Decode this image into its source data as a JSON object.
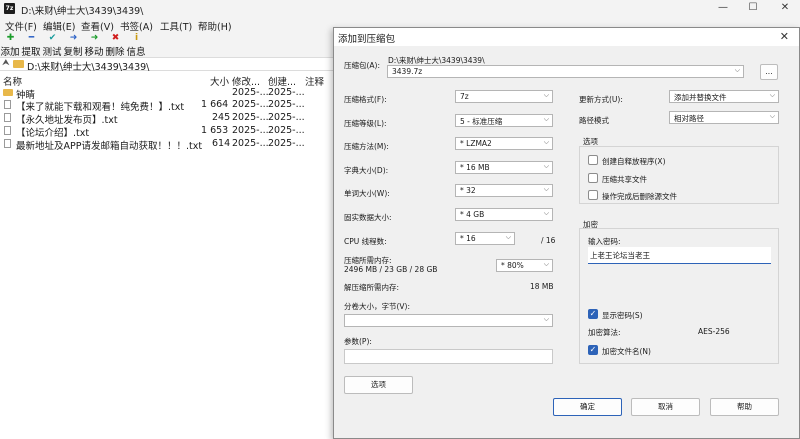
{
  "window": {
    "app_icon": "7z",
    "title": "D:\\来财\\绅士大\\3439\\3439\\"
  },
  "menu": [
    "文件(F)",
    "编辑(E)",
    "查看(V)",
    "书签(A)",
    "工具(T)",
    "帮助(H)"
  ],
  "toolbar": [
    {
      "label": "添加",
      "icon": "plus-icon",
      "glyph": "✚",
      "color": "#1a9c2a"
    },
    {
      "label": "提取",
      "icon": "minus-icon",
      "glyph": "━",
      "color": "#2e63c7"
    },
    {
      "label": "测试",
      "icon": "check-icon",
      "glyph": "✔",
      "color": "#1a9c9c"
    },
    {
      "label": "复制",
      "icon": "arrow-right-icon",
      "glyph": "➜",
      "color": "#2e63c7"
    },
    {
      "label": "移动",
      "icon": "arrow-move-icon",
      "glyph": "➜",
      "color": "#1a9c2a"
    },
    {
      "label": "删除",
      "icon": "x-icon",
      "glyph": "✖",
      "color": "#d01d1d"
    },
    {
      "label": "信息",
      "icon": "info-icon",
      "glyph": "i",
      "color": "#c99a10"
    }
  ],
  "address": {
    "path": "D:\\来财\\绅士大\\3439\\3439\\"
  },
  "columns": {
    "name": "名称",
    "size": "大小",
    "modified": "修改...",
    "created": "创建...",
    "comment": "注释"
  },
  "files": [
    {
      "name": "钟睛",
      "size": "",
      "modified": "2025-...",
      "created": "2025-...",
      "type": "folder"
    },
    {
      "name": "【来了就能下载和观看！纯免费！】.txt",
      "size": "1 664",
      "modified": "2025-...",
      "created": "2025-...",
      "type": "file"
    },
    {
      "name": "【永久地址发布页】.txt",
      "size": "245",
      "modified": "2025-...",
      "created": "2025-...",
      "type": "file"
    },
    {
      "name": "【论坛介绍】.txt",
      "size": "1 653",
      "modified": "2025-...",
      "created": "2025-...",
      "type": "file"
    },
    {
      "name": "最新地址及APP请发邮箱自动获取！！！.txt",
      "size": "614",
      "modified": "2025-...",
      "created": "2025-...",
      "type": "file"
    }
  ],
  "dialog": {
    "title": "添加到压缩包",
    "close": "✕",
    "archive_label": "压缩包(A):",
    "archive_dir": "D:\\来财\\绅士大\\3439\\3439\\",
    "archive_name": "3439.7z",
    "browse": "...",
    "format_label": "压缩格式(F):",
    "format": "7z",
    "level_label": "压缩等级(L):",
    "level": "5 - 标准压缩",
    "method_label": "压缩方法(M):",
    "method": "*  LZMA2",
    "dict_label": "字典大小(D):",
    "dict": "*  16 MB",
    "word_label": "单词大小(W):",
    "word": "*  32",
    "solid_label": "固实数据大小:",
    "solid": "*  4 GB",
    "threads_label": "CPU 线程数:",
    "threads": "*  16",
    "threads_total": "/ 16",
    "mem_label": "压缩所需内存:",
    "mem_value": "2496 MB / 23 GB / 28 GB",
    "mem_pct": "*  80%",
    "decomp_label": "解压缩所需内存:",
    "decomp_value": "18 MB",
    "split_label": "分卷大小，字节(V):",
    "split": "",
    "params_label": "参数(P):",
    "params": "",
    "options_btn": "选项",
    "update_label": "更新方式(U):",
    "update": "添加并替换文件",
    "pathmode_label": "路径模式",
    "pathmode": "相对路径",
    "options_group": "选项",
    "opt_sfx": "创建自释放程序(X)",
    "opt_shared": "压缩共享文件",
    "opt_delete": "操作完成后删除源文件",
    "enc_group": "加密",
    "pwd_label": "输入密码:",
    "pwd_value": "上老王论坛当老王",
    "show_pwd": "显示密码(S)",
    "enc_method_label": "加密算法:",
    "enc_method": "AES-256",
    "enc_names": "加密文件名(N)",
    "ok": "确定",
    "cancel": "取消",
    "help": "帮助"
  }
}
